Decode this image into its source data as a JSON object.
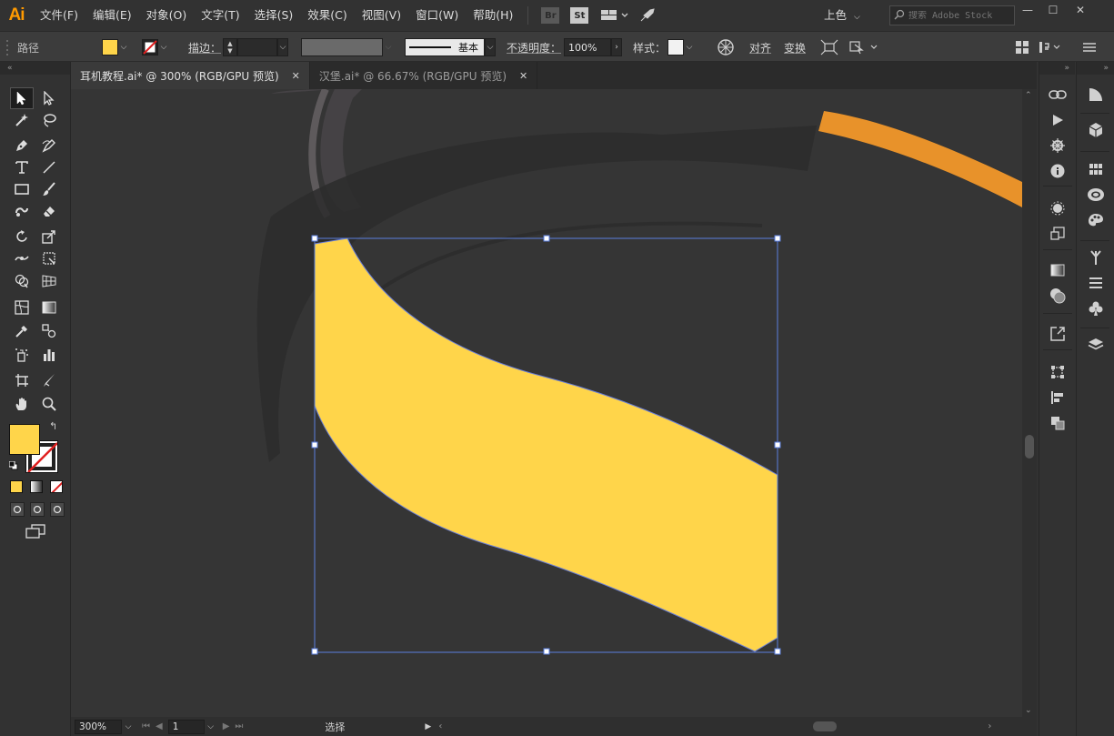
{
  "app": {
    "logo": "Ai"
  },
  "menu": [
    "文件(F)",
    "编辑(E)",
    "对象(O)",
    "文字(T)",
    "选择(S)",
    "效果(C)",
    "视图(V)",
    "窗口(W)",
    "帮助(H)"
  ],
  "menu_icons": {
    "bridge": "Br",
    "stock": "St"
  },
  "workspace": {
    "label": "上色"
  },
  "search": {
    "placeholder": "搜索 Adobe Stock"
  },
  "control": {
    "selection_type": "路径",
    "fill_color": "#ffd54a",
    "stroke_label": "描边：",
    "stroke_profile": "基本",
    "opacity_label": "不透明度：",
    "opacity_value": "100%",
    "style_label": "样式：",
    "align_label": "对齐",
    "transform_label": "变换"
  },
  "tabs": [
    {
      "label": "耳机教程.ai* @ 300% (RGB/GPU 预览)",
      "active": true
    },
    {
      "label": "汉堡.ai* @ 66.67% (RGB/GPU 预览)",
      "active": false
    }
  ],
  "toolbar": {
    "fill_color": "#ffd54a",
    "tools": [
      "selection-tool",
      "direct-selection-tool",
      "magic-wand-tool",
      "lasso-tool",
      "pen-tool",
      "curvature-tool",
      "type-tool",
      "line-tool",
      "rectangle-tool",
      "paintbrush-tool",
      "shaper-tool",
      "eraser-tool",
      "rotate-tool",
      "scale-tool",
      "width-tool",
      "free-transform-tool",
      "shape-builder-tool",
      "perspective-grid-tool",
      "mesh-tool",
      "gradient-tool",
      "eyedropper-tool",
      "blend-tool",
      "symbol-sprayer-tool",
      "column-graph-tool",
      "artboard-tool",
      "slice-tool",
      "hand-tool",
      "zoom-tool"
    ]
  },
  "status": {
    "zoom": "300%",
    "artboard": "1",
    "tool": "选择"
  },
  "colors": {
    "shape_fill": "#ffd54a",
    "accent_orange": "#e8922a",
    "selection": "#5b7fe0"
  }
}
